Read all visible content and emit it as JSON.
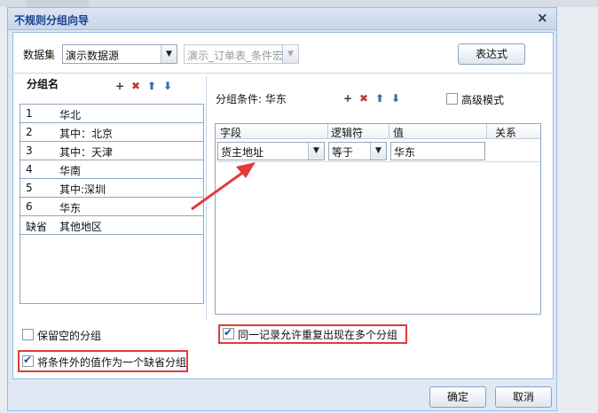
{
  "dialog": {
    "title": "不规则分组向导",
    "close_icon": "×"
  },
  "toolbar": {
    "dataset_label": "数据集",
    "dataset_value": "演示数据源",
    "table_value": "演示_订单表_条件宏",
    "expression_button": "表达式"
  },
  "left": {
    "header": "分组名",
    "actions": {
      "add": "+",
      "delete": "✖",
      "up": "⬆",
      "down": "⬇"
    },
    "rows": [
      {
        "num": "1",
        "name": "华北"
      },
      {
        "num": "2",
        "name": "其中：北京"
      },
      {
        "num": "3",
        "name": "其中：天津"
      },
      {
        "num": "4",
        "name": "华南"
      },
      {
        "num": "5",
        "name": "其中:深圳"
      },
      {
        "num": "6",
        "name": "华东"
      },
      {
        "num": "缺省",
        "name": "其他地区"
      }
    ]
  },
  "right": {
    "condition_label": "分组条件: 华东",
    "advanced_mode_label": "高级模式",
    "advanced_mode_checked": false,
    "columns": [
      "字段",
      "逻辑符",
      "值",
      "关系"
    ],
    "row": {
      "field": "货主地址",
      "op": "等于",
      "value": "华东",
      "relation": ""
    }
  },
  "options": {
    "keep_empty_label": "保留空的分组",
    "keep_empty_checked": false,
    "allow_repeat_label": "同一记录允许重复出现在多个分组",
    "allow_repeat_checked": true,
    "default_group_label": "将条件外的值作为一个缺省分组",
    "default_group_checked": true
  },
  "footer": {
    "ok": "确定",
    "cancel": "取消"
  },
  "colors": {
    "annotation_red": "#e23b3b",
    "accent_blue": "#99bbe8"
  }
}
